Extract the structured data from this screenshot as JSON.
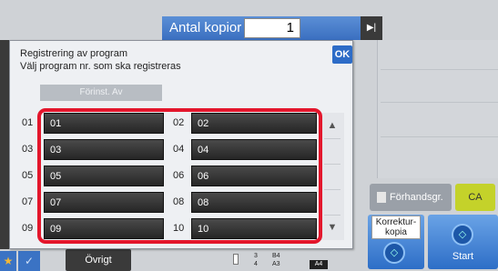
{
  "header": {
    "copies_label": "Antal kopior",
    "copies_value": "1"
  },
  "dialog": {
    "title": "Registrering av program",
    "subtitle": "Välj program nr. som ska registreras",
    "ok_label": "OK",
    "preset_label": "Förinst. Av",
    "programs": [
      {
        "num": "01",
        "label": "01"
      },
      {
        "num": "02",
        "label": "02"
      },
      {
        "num": "03",
        "label": "03"
      },
      {
        "num": "04",
        "label": "04"
      },
      {
        "num": "05",
        "label": "05"
      },
      {
        "num": "06",
        "label": "06"
      },
      {
        "num": "07",
        "label": "07"
      },
      {
        "num": "08",
        "label": "08"
      },
      {
        "num": "09",
        "label": "09"
      },
      {
        "num": "10",
        "label": "10"
      }
    ]
  },
  "right": {
    "preview_label": "Förhandsgr.",
    "ca_label": "CA",
    "proof_label": "Korrektur-kopia",
    "start_label": "Start"
  },
  "bottom": {
    "other_label": "Övrigt",
    "paper": {
      "row1_num": "3",
      "row1_size": "B4",
      "row2_num": "4",
      "row2_size": "A3",
      "selected": "A4"
    }
  },
  "colors": {
    "accent": "#2d6cc7",
    "highlight": "#e3162c",
    "ca": "#c4d22a",
    "star": "#f2b736"
  }
}
